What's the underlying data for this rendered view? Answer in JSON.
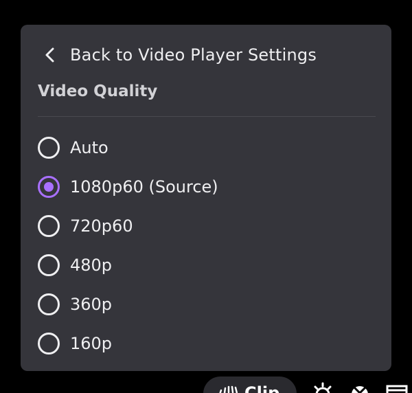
{
  "menu": {
    "back_label": "Back to Video Player Settings",
    "section_title": "Video Quality",
    "selected_index": 1,
    "accent_color": "#a970ff",
    "options": [
      {
        "label": "Auto",
        "selected": false
      },
      {
        "label": "1080p60 (Source)",
        "selected": true
      },
      {
        "label": "720p60",
        "selected": false
      },
      {
        "label": "480p",
        "selected": false
      },
      {
        "label": "360p",
        "selected": false
      },
      {
        "label": "160p",
        "selected": false
      }
    ]
  },
  "controls": {
    "clip_label": "Clip",
    "icons": [
      "clip-icon",
      "settings-icon",
      "theatre-mode-icon",
      "fullscreen-icon"
    ]
  }
}
